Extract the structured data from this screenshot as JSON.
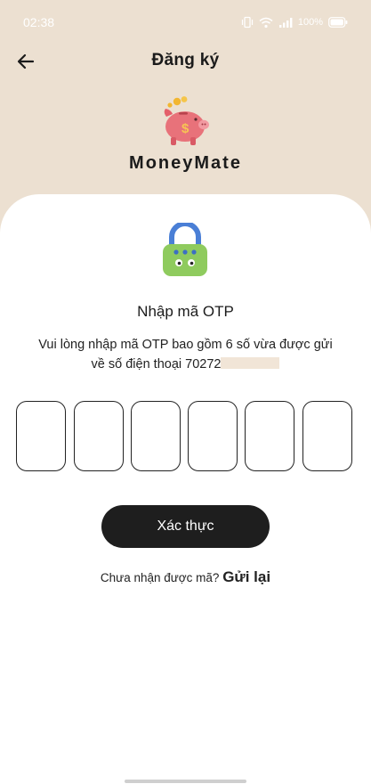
{
  "status_bar": {
    "time": "02:38",
    "battery": "100%"
  },
  "header": {
    "title": "Đăng ký"
  },
  "brand": {
    "name": "MoneyMate"
  },
  "otp": {
    "title": "Nhập mã OTP",
    "description_line1": "Vui lòng nhập mã OTP bao gồm 6 số vừa được gửi",
    "description_line2": "về số điện thoại 70272",
    "digits": [
      "",
      "",
      "",
      "",
      "",
      ""
    ]
  },
  "actions": {
    "verify_label": "Xác thực"
  },
  "resend": {
    "prompt": "Chưa nhận được mã?",
    "link": "Gửi lại"
  },
  "colors": {
    "background": "#ece0d1",
    "card": "#ffffff",
    "button": "#1e1e1e",
    "accent_pig": "#e8727a",
    "lock_shackle": "#4a7fd6",
    "lock_body": "#8fcb5e"
  },
  "icons": [
    "back-arrow-icon",
    "vibrate-icon",
    "wifi-icon",
    "signal-icon",
    "battery-icon",
    "piggy-bank-icon",
    "lock-icon"
  ]
}
